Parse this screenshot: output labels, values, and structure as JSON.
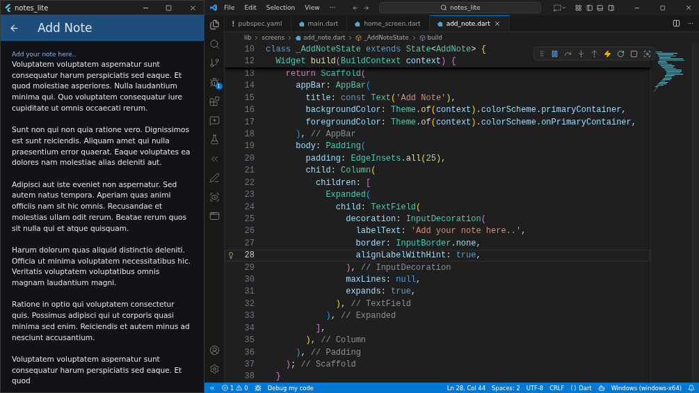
{
  "flutter_window": {
    "title": "notes_lite",
    "app_bar": {
      "title": "Add Note"
    },
    "note_field": {
      "label": "Add your note here..",
      "paragraphs": [
        "Voluptatem voluptatem aspernatur sunt consequatur harum perspiciatis sed eaque. Et quod molestiae asperiores. Nulla laudantium minima qui. Quo voluptatem consequatur iure cupiditate ut omnis occaecati rerum.",
        "Sunt non qui non quia ratione vero. Dignissimos est sunt reiciendis. Aliquam amet qui nulla praesentium error quaerat. Eaque voluptates ea dolores nam molestiae alias deleniti aut.",
        "Adipisci aut iste eveniet non aspernatur. Sed autem natus tempora. Aperiam quas animi officiis nam sit hic omnis. Recusandae et molestias ullam odit rerum. Beatae rerum quos sit nulla qui et atque quisquam.",
        "Harum dolorum quas aliquid distinctio deleniti. Officia ut minima voluptatem necessitatibus hic. Veritatis voluptatem voluptatibus omnis magnam laudantium magni.",
        "Ratione in optio qui voluptatem consectetur quis. Possimus adipisci qui ut corporis quasi minima sed enim. Reiciendis et autem minus ad nesciunt accusantium.",
        "Voluptatem voluptatem aspernatur sunt consequatur harum perspiciatis sed eaque. Et quod"
      ]
    }
  },
  "vscode": {
    "menu": [
      "File",
      "Edit",
      "Selection",
      "View",
      "···"
    ],
    "search": "notes_lite",
    "tabs": [
      {
        "label": "pubspec.yaml",
        "kind": "yaml",
        "glyph": "!",
        "selected": false
      },
      {
        "label": "main.dart",
        "kind": "dart",
        "selected": false
      },
      {
        "label": "home_screen.dart",
        "kind": "dart",
        "selected": false
      },
      {
        "label": "add_note.dart",
        "kind": "dart",
        "selected": true
      }
    ],
    "tab_more": "···",
    "breadcrumb": [
      {
        "label": "lib",
        "kind": "folder"
      },
      {
        "label": "screens",
        "kind": "folder"
      },
      {
        "label": "add_note.dart",
        "kind": "dart"
      },
      {
        "label": "_AddNoteState",
        "kind": "class"
      },
      {
        "label": "build",
        "kind": "method"
      }
    ],
    "sticky_lines": [
      {
        "number": "10",
        "current": false,
        "tokens": [
          {
            "kind": "keyword",
            "text": "class"
          },
          {
            "kind": "type",
            "text": " _AddNoteState"
          },
          {
            "kind": "keyword",
            "text": " extends"
          },
          {
            "kind": "type",
            "text": " State"
          },
          {
            "kind": "plain",
            "text": "<"
          },
          {
            "kind": "type",
            "text": "AddNote"
          },
          {
            "kind": "plain",
            "text": ">"
          },
          {
            "kind": "bracket1",
            "text": " {"
          }
        ]
      },
      {
        "number": "12",
        "current": false,
        "tokens": [
          {
            "kind": "type",
            "text": "  Widget"
          },
          {
            "kind": "function",
            "text": " build"
          },
          {
            "kind": "bracket2",
            "text": "("
          },
          {
            "kind": "type",
            "text": "BuildContext"
          },
          {
            "kind": "property",
            "text": " context"
          },
          {
            "kind": "bracket2",
            "text": ")"
          },
          {
            "kind": "bracket2",
            "text": " {"
          }
        ]
      }
    ],
    "lines": [
      {
        "number": "13",
        "current": false,
        "tokens": [
          {
            "kind": "control",
            "text": "    return"
          },
          {
            "kind": "type",
            "text": " Scaffold"
          },
          {
            "kind": "bracket2",
            "text": "("
          }
        ]
      },
      {
        "number": "14",
        "current": false,
        "tokens": [
          {
            "kind": "property",
            "text": "      appBar"
          },
          {
            "kind": "plain",
            "text": ":"
          },
          {
            "kind": "type",
            "text": " AppBar"
          },
          {
            "kind": "bracket3",
            "text": "("
          }
        ]
      },
      {
        "number": "15",
        "current": false,
        "tokens": [
          {
            "kind": "property",
            "text": "        title"
          },
          {
            "kind": "plain",
            "text": ":"
          },
          {
            "kind": "keyword",
            "text": " const"
          },
          {
            "kind": "type",
            "text": " Text"
          },
          {
            "kind": "bracket1",
            "text": "("
          },
          {
            "kind": "string",
            "text": "'Add Note'"
          },
          {
            "kind": "bracket1",
            "text": ")"
          },
          {
            "kind": "plain",
            "text": ","
          }
        ]
      },
      {
        "number": "16",
        "current": false,
        "tokens": [
          {
            "kind": "property",
            "text": "        backgroundColor"
          },
          {
            "kind": "plain",
            "text": ":"
          },
          {
            "kind": "type",
            "text": " Theme"
          },
          {
            "kind": "plain",
            "text": "."
          },
          {
            "kind": "function",
            "text": "of"
          },
          {
            "kind": "bracket1",
            "text": "("
          },
          {
            "kind": "property",
            "text": "context"
          },
          {
            "kind": "bracket1",
            "text": ")"
          },
          {
            "kind": "plain",
            "text": "."
          },
          {
            "kind": "property",
            "text": "colorScheme"
          },
          {
            "kind": "plain",
            "text": "."
          },
          {
            "kind": "property",
            "text": "primaryContainer"
          },
          {
            "kind": "plain",
            "text": ","
          }
        ]
      },
      {
        "number": "17",
        "current": false,
        "tokens": [
          {
            "kind": "property",
            "text": "        foregroundColor"
          },
          {
            "kind": "plain",
            "text": ":"
          },
          {
            "kind": "type",
            "text": " Theme"
          },
          {
            "kind": "plain",
            "text": "."
          },
          {
            "kind": "function",
            "text": "of"
          },
          {
            "kind": "bracket1",
            "text": "("
          },
          {
            "kind": "property",
            "text": "context"
          },
          {
            "kind": "bracket1",
            "text": ")"
          },
          {
            "kind": "plain",
            "text": "."
          },
          {
            "kind": "property",
            "text": "colorScheme"
          },
          {
            "kind": "plain",
            "text": "."
          },
          {
            "kind": "property",
            "text": "onPrimaryContainer"
          },
          {
            "kind": "plain",
            "text": ","
          }
        ]
      },
      {
        "number": "18",
        "current": false,
        "tokens": [
          {
            "kind": "bracket3",
            "text": "      )"
          },
          {
            "kind": "plain",
            "text": ","
          },
          {
            "kind": "comment",
            "text": " // AppBar"
          }
        ]
      },
      {
        "number": "19",
        "current": false,
        "tokens": [
          {
            "kind": "property",
            "text": "      body"
          },
          {
            "kind": "plain",
            "text": ":"
          },
          {
            "kind": "type",
            "text": " Padding"
          },
          {
            "kind": "bracket3",
            "text": "("
          }
        ]
      },
      {
        "number": "20",
        "current": false,
        "tokens": [
          {
            "kind": "property",
            "text": "        padding"
          },
          {
            "kind": "plain",
            "text": ":"
          },
          {
            "kind": "type",
            "text": " EdgeInsets"
          },
          {
            "kind": "plain",
            "text": "."
          },
          {
            "kind": "function",
            "text": "all"
          },
          {
            "kind": "bracket1",
            "text": "("
          },
          {
            "kind": "number",
            "text": "25"
          },
          {
            "kind": "bracket1",
            "text": ")"
          },
          {
            "kind": "plain",
            "text": ","
          }
        ]
      },
      {
        "number": "21",
        "current": false,
        "tokens": [
          {
            "kind": "property",
            "text": "        child"
          },
          {
            "kind": "plain",
            "text": ":"
          },
          {
            "kind": "type",
            "text": " Column"
          },
          {
            "kind": "bracket1",
            "text": "("
          }
        ]
      },
      {
        "number": "22",
        "current": false,
        "tokens": [
          {
            "kind": "property",
            "text": "          children"
          },
          {
            "kind": "plain",
            "text": ":"
          },
          {
            "kind": "bracket2",
            "text": " ["
          }
        ]
      },
      {
        "number": "23",
        "current": false,
        "tokens": [
          {
            "kind": "type",
            "text": "            Expanded"
          },
          {
            "kind": "bracket3",
            "text": "("
          }
        ]
      },
      {
        "number": "24",
        "current": false,
        "tokens": [
          {
            "kind": "property",
            "text": "              child"
          },
          {
            "kind": "plain",
            "text": ":"
          },
          {
            "kind": "type",
            "text": " TextField"
          },
          {
            "kind": "bracket1",
            "text": "("
          }
        ]
      },
      {
        "number": "25",
        "current": false,
        "tokens": [
          {
            "kind": "property",
            "text": "                decoration"
          },
          {
            "kind": "plain",
            "text": ":"
          },
          {
            "kind": "type",
            "text": " InputDecoration"
          },
          {
            "kind": "bracket2",
            "text": "("
          }
        ]
      },
      {
        "number": "26",
        "current": false,
        "tokens": [
          {
            "kind": "property",
            "text": "                  labelText"
          },
          {
            "kind": "plain",
            "text": ":"
          },
          {
            "kind": "string",
            "text": " 'Add your note here..'"
          },
          {
            "kind": "plain",
            "text": ","
          }
        ]
      },
      {
        "number": "27",
        "current": false,
        "tokens": [
          {
            "kind": "property",
            "text": "                  border"
          },
          {
            "kind": "plain",
            "text": ":"
          },
          {
            "kind": "type",
            "text": " InputBorder"
          },
          {
            "kind": "plain",
            "text": "."
          },
          {
            "kind": "property",
            "text": "none"
          },
          {
            "kind": "plain",
            "text": ","
          }
        ]
      },
      {
        "number": "28",
        "current": true,
        "tokens": [
          {
            "kind": "property",
            "text": "                  alignLabelWithHint"
          },
          {
            "kind": "plain",
            "text": ":"
          },
          {
            "kind": "keyword",
            "text": " true"
          },
          {
            "kind": "plain",
            "text": ","
          }
        ]
      },
      {
        "number": "29",
        "current": false,
        "tokens": [
          {
            "kind": "bracket2",
            "text": "                )"
          },
          {
            "kind": "plain",
            "text": ","
          },
          {
            "kind": "comment",
            "text": " // InputDecoration"
          }
        ]
      },
      {
        "number": "30",
        "current": false,
        "tokens": [
          {
            "kind": "property",
            "text": "                maxLines"
          },
          {
            "kind": "plain",
            "text": ":"
          },
          {
            "kind": "keyword",
            "text": " null"
          },
          {
            "kind": "plain",
            "text": ","
          }
        ]
      },
      {
        "number": "31",
        "current": false,
        "tokens": [
          {
            "kind": "property",
            "text": "                expands"
          },
          {
            "kind": "plain",
            "text": ":"
          },
          {
            "kind": "keyword",
            "text": " true"
          },
          {
            "kind": "plain",
            "text": ","
          }
        ]
      },
      {
        "number": "32",
        "current": false,
        "tokens": [
          {
            "kind": "bracket1",
            "text": "              )"
          },
          {
            "kind": "plain",
            "text": ","
          },
          {
            "kind": "comment",
            "text": " // TextField"
          }
        ]
      },
      {
        "number": "33",
        "current": false,
        "tokens": [
          {
            "kind": "bracket3",
            "text": "            )"
          },
          {
            "kind": "plain",
            "text": ","
          },
          {
            "kind": "comment",
            "text": " // Expanded"
          }
        ]
      },
      {
        "number": "34",
        "current": false,
        "tokens": [
          {
            "kind": "bracket2",
            "text": "          ]"
          },
          {
            "kind": "plain",
            "text": ","
          }
        ]
      },
      {
        "number": "35",
        "current": false,
        "tokens": [
          {
            "kind": "bracket1",
            "text": "        )"
          },
          {
            "kind": "plain",
            "text": ","
          },
          {
            "kind": "comment",
            "text": " // Column"
          }
        ]
      },
      {
        "number": "36",
        "current": false,
        "tokens": [
          {
            "kind": "bracket3",
            "text": "      )"
          },
          {
            "kind": "plain",
            "text": ","
          },
          {
            "kind": "comment",
            "text": " // Padding"
          }
        ]
      },
      {
        "number": "37",
        "current": false,
        "tokens": [
          {
            "kind": "bracket2",
            "text": "    )"
          },
          {
            "kind": "plain",
            "text": ";"
          },
          {
            "kind": "comment",
            "text": " // Scaffold"
          }
        ]
      },
      {
        "number": "38",
        "current": false,
        "tokens": [
          {
            "kind": "bracket2",
            "text": "  }"
          }
        ]
      }
    ],
    "debug_badge": "1",
    "status_bar": {
      "errors": "1",
      "warnings": "0",
      "debug": "Debug my code",
      "right": [
        {
          "label": "Ln 28, Col 44",
          "kind": "text"
        },
        {
          "label": "Spaces: 2",
          "kind": "text"
        },
        {
          "label": "UTF-8",
          "kind": "text"
        },
        {
          "label": "CRLF",
          "kind": "text"
        },
        {
          "label": "Dart",
          "kind": "language"
        },
        {
          "kind": "copilot"
        },
        {
          "label": "Windows (windows-x64)",
          "kind": "text"
        }
      ]
    }
  }
}
